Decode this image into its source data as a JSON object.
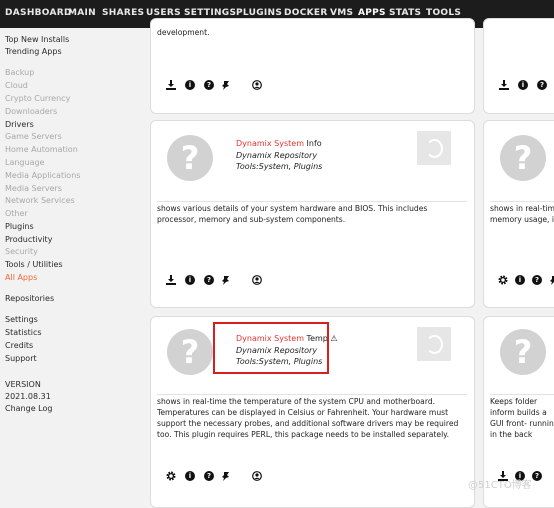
{
  "nav": {
    "items": [
      "DASHBOARD",
      "MAIN",
      "SHARES",
      "USERS",
      "SETTINGS",
      "PLUGINS",
      "DOCKER",
      "VMS",
      "APPS",
      "STATS",
      "TOOLS"
    ],
    "active": "APPS"
  },
  "sidebar": {
    "items": [
      {
        "label": "Top New Installs",
        "style": "dark"
      },
      {
        "label": "Trending Apps",
        "style": "dark"
      },
      {
        "label": "Backup",
        "style": "muted"
      },
      {
        "label": "Cloud",
        "style": "muted"
      },
      {
        "label": "Crypto Currency",
        "style": "muted"
      },
      {
        "label": "Downloaders",
        "style": "muted"
      },
      {
        "label": "Drivers",
        "style": "dark"
      },
      {
        "label": "Game Servers",
        "style": "muted"
      },
      {
        "label": "Home Automation",
        "style": "muted"
      },
      {
        "label": "Language",
        "style": "muted"
      },
      {
        "label": "Media Applications",
        "style": "muted"
      },
      {
        "label": "Media Servers",
        "style": "muted"
      },
      {
        "label": "Network Services",
        "style": "muted"
      },
      {
        "label": "Other",
        "style": "muted"
      },
      {
        "label": "Plugins",
        "style": "dark"
      },
      {
        "label": "Productivity",
        "style": "dark"
      },
      {
        "label": "Security",
        "style": "muted"
      },
      {
        "label": "Tools / Utilities",
        "style": "dark"
      },
      {
        "label": "All Apps",
        "style": "active"
      },
      {
        "label": "Repositories",
        "style": "dark"
      },
      {
        "label": "Settings",
        "style": "dark"
      },
      {
        "label": "Statistics",
        "style": "dark"
      },
      {
        "label": "Credits",
        "style": "dark"
      },
      {
        "label": "Support",
        "style": "dark"
      },
      {
        "label": "VERSION",
        "style": "dark"
      },
      {
        "label": "2021.08.31",
        "style": "dark"
      },
      {
        "label": "Change Log",
        "style": "dark"
      }
    ]
  },
  "cards": {
    "top_partial": {
      "text": "development."
    },
    "info": {
      "title_red": "Dynamix System",
      "title_black": "Info",
      "repo": "Dynamix Repository",
      "category": "Tools:System, Plugins",
      "description": "shows various details of your system hardware and BIOS. This includes processor, memory and sub-system components."
    },
    "temp": {
      "title_red": "Dynamix System",
      "title_black": "Temp",
      "warning": "⚠",
      "repo": "Dynamix Repository",
      "category": "Tools:System, Plugins",
      "description": "shows in real-time the temperature of the system CPU and motherboard. Temperatures can be displayed in Celsius or Fahrenheit. Your hardware must support the necessary probes, and additional software drivers may be required too. This plugin requires PERL, this package needs to be installed separately."
    },
    "right_middle": {
      "description": "shows in real-time memory usage, int"
    },
    "right_bottom": {
      "description": "Keeps folder inform builds a GUI front- running in the back"
    }
  },
  "icons": {
    "install": "download-icon",
    "info": "info-icon",
    "support": "help-icon",
    "pin": "pin-icon",
    "settings": "gear-icon",
    "profile": "profile-icon"
  },
  "watermark": "@51CTO博客",
  "colors": {
    "accent": "#f0683a",
    "title_red": "#e3342f",
    "nav_bg": "#1c1c1c",
    "highlight": "#d81e1e"
  }
}
